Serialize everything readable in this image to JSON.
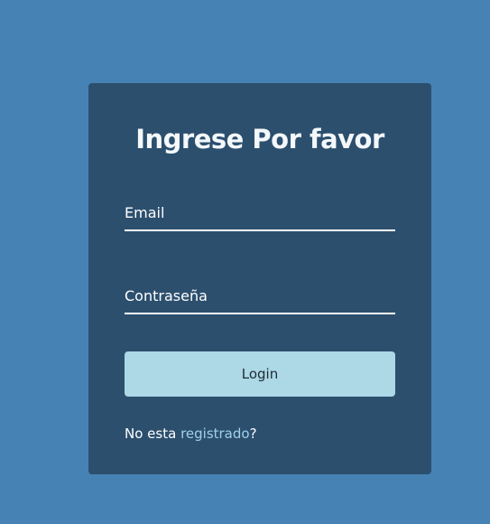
{
  "login_form": {
    "title": "Ingrese Por favor",
    "email_placeholder": "Email",
    "password_placeholder": "Contraseña",
    "login_label": "Login",
    "register_prefix": "No esta ",
    "register_link_label": "registrado",
    "register_suffix": "?"
  },
  "colors": {
    "page_background": "#4682b4",
    "card_background": "#2c4f6e",
    "button_background": "#add8e6",
    "link": "#9fd1eb"
  }
}
